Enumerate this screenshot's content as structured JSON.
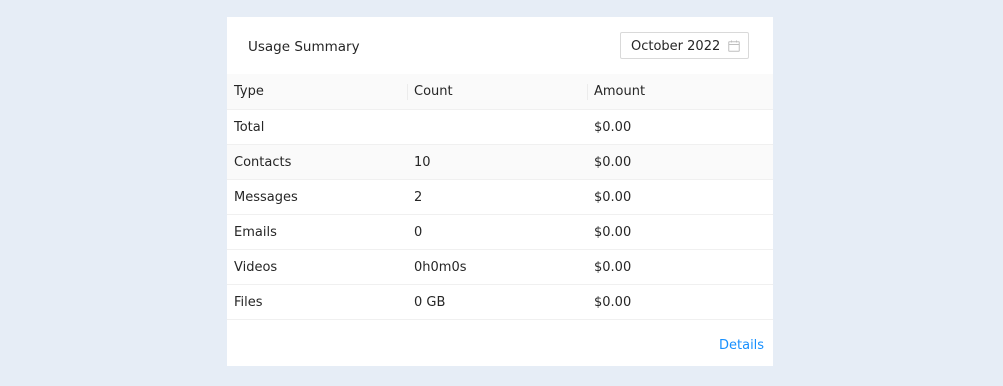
{
  "card": {
    "title": "Usage Summary",
    "date_picker": {
      "value": "October 2022",
      "icon": "calendar-icon"
    },
    "details_label": "Details",
    "accent_color": "#1890ff"
  },
  "table": {
    "headers": [
      "Type",
      "Count",
      "Amount"
    ],
    "rows": [
      {
        "type": "Total",
        "count": "",
        "amount": "$0.00"
      },
      {
        "type": "Contacts",
        "count": "10",
        "amount": "$0.00"
      },
      {
        "type": "Messages",
        "count": "2",
        "amount": "$0.00"
      },
      {
        "type": "Emails",
        "count": "0",
        "amount": "$0.00"
      },
      {
        "type": "Videos",
        "count": "0h0m0s",
        "amount": "$0.00"
      },
      {
        "type": "Files",
        "count": "0 GB",
        "amount": "$0.00"
      }
    ]
  }
}
